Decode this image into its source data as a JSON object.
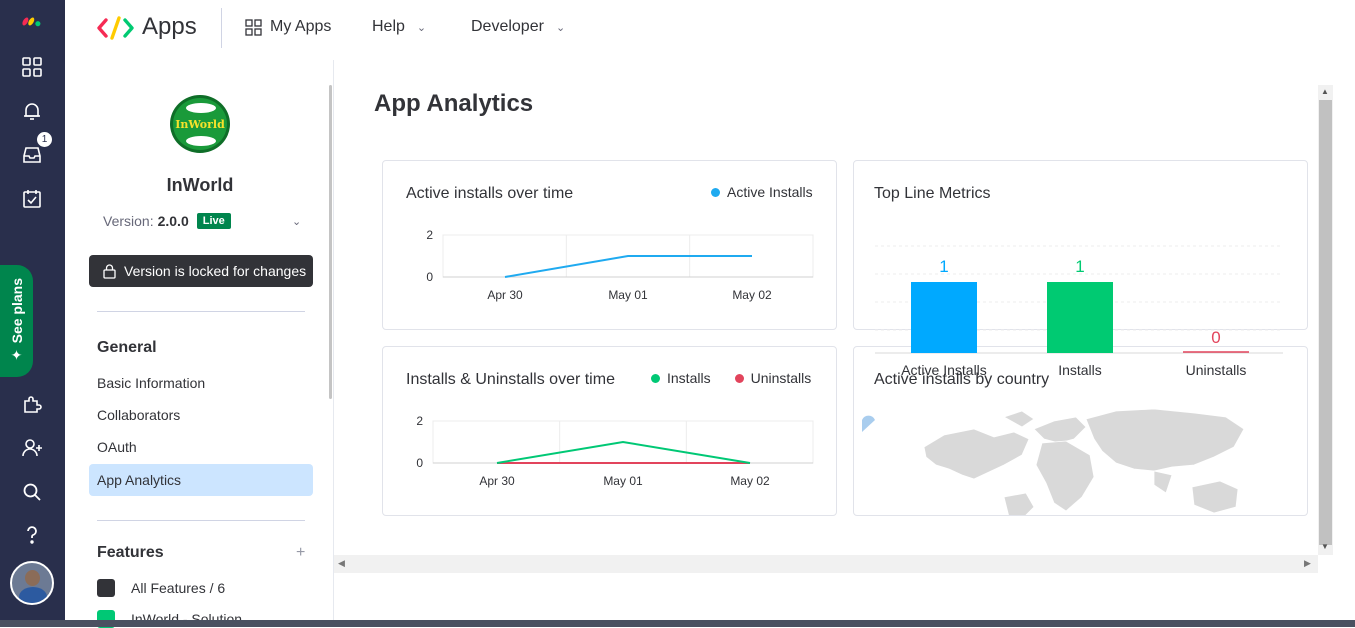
{
  "rail": {
    "inbox_badge": "1",
    "see_plans": "See plans"
  },
  "topbar": {
    "title": "Apps",
    "nav": [
      {
        "label": "My Apps"
      },
      {
        "label": "Help"
      },
      {
        "label": "Developer"
      }
    ]
  },
  "sidebar": {
    "app_logo_text": "InWorld",
    "app_name": "InWorld",
    "version_label": "Version:",
    "version_value": "2.0.0",
    "status_badge": "Live",
    "locked_message": "Version is locked for changes",
    "general_title": "General",
    "general_items": [
      {
        "label": "Basic Information"
      },
      {
        "label": "Collaborators"
      },
      {
        "label": "OAuth"
      },
      {
        "label": "App Analytics"
      }
    ],
    "features_title": "Features",
    "features_add": "+",
    "features_items": [
      {
        "label": "All Features / 6"
      },
      {
        "label": "InWorld - Solution"
      }
    ]
  },
  "main": {
    "page_title": "App Analytics",
    "cards": {
      "active_installs_title": "Active installs over time",
      "installs_uninstalls_title": "Installs & Uninstalls over time",
      "top_line_title": "Top Line Metrics",
      "by_country_title": "Active installs by country"
    }
  },
  "colors": {
    "active_installs": "#1faaf0",
    "installs": "#00c875",
    "uninstalls": "#e2445c",
    "bar_active": "#00a9ff",
    "bar_installs": "#00ca72"
  },
  "chart_data": [
    {
      "type": "line",
      "title": "Active installs over time",
      "categories": [
        "Apr 30",
        "May 01",
        "May 02"
      ],
      "series": [
        {
          "name": "Active Installs",
          "values": [
            0,
            1,
            1
          ]
        }
      ],
      "yticks": [
        "2",
        "0"
      ],
      "ylim": [
        0,
        2
      ],
      "legend": "top-right",
      "grid": true
    },
    {
      "type": "line",
      "title": "Installs & Uninstalls over time",
      "categories": [
        "Apr 30",
        "May 01",
        "May 02"
      ],
      "series": [
        {
          "name": "Installs",
          "values": [
            0,
            1,
            0
          ]
        },
        {
          "name": "Uninstalls",
          "values": [
            0,
            0,
            0
          ]
        }
      ],
      "yticks": [
        "2",
        "0"
      ],
      "ylim": [
        0,
        2
      ],
      "legend": "top-right",
      "grid": true
    },
    {
      "type": "bar",
      "title": "Top Line Metrics",
      "categories": [
        "Active Installs",
        "Installs",
        "Uninstalls"
      ],
      "values": [
        1,
        1,
        0
      ],
      "value_labels": [
        "1",
        "1",
        "0"
      ]
    }
  ]
}
